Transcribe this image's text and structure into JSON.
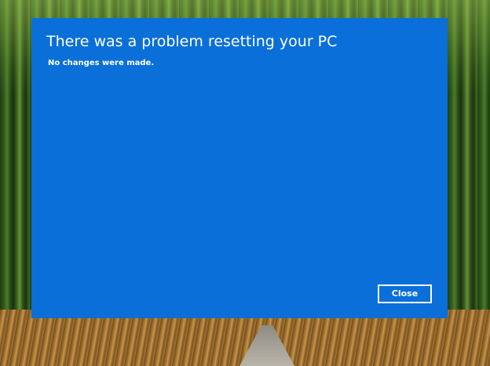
{
  "dialog": {
    "title": "There was a problem resetting your PC",
    "message": "No changes were made.",
    "close_label": "Close",
    "background_color": "#0a6fd8",
    "text_color": "#ffffff"
  }
}
